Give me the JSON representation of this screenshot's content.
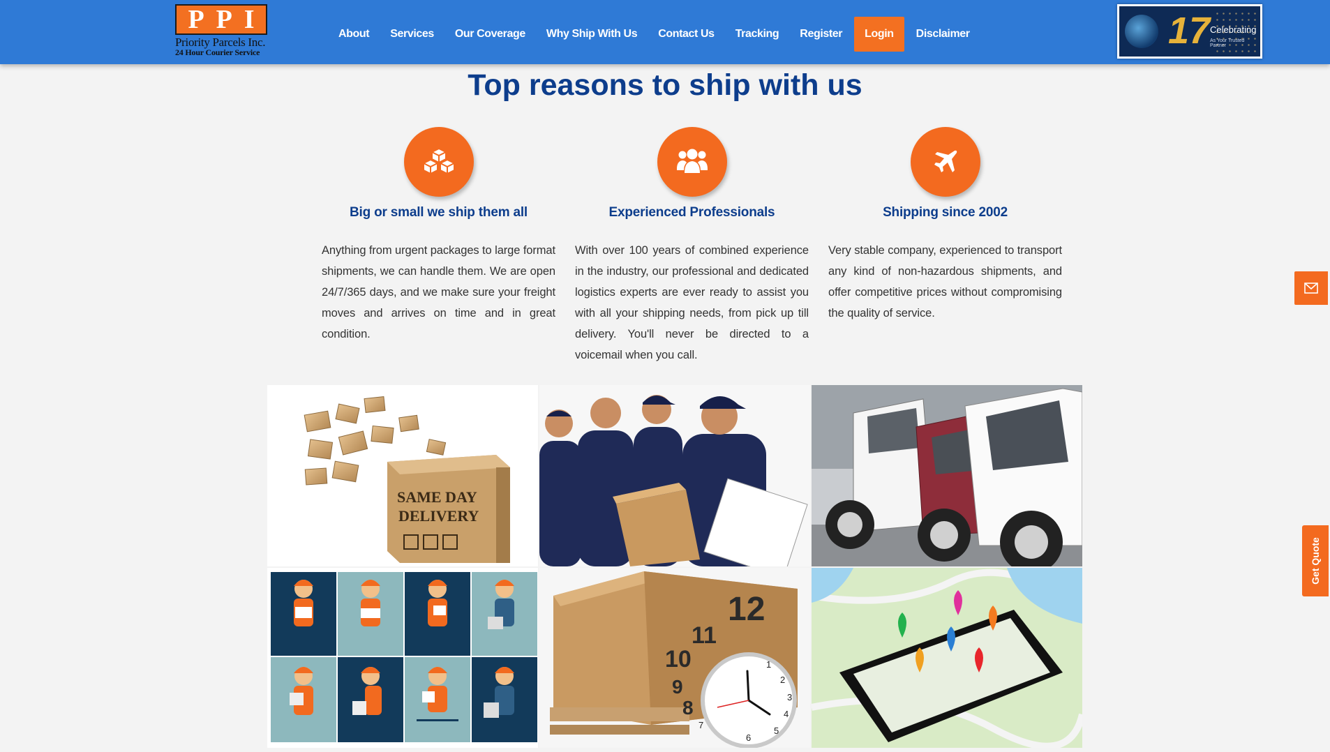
{
  "header": {
    "logo": {
      "letters": [
        "P",
        "P",
        "I"
      ],
      "name": "Priority Parcels Inc.",
      "tagline": "24 Hour Courier Service"
    },
    "nav": [
      "About",
      "Services",
      "Our Coverage",
      "Why Ship With Us",
      "Contact Us",
      "Tracking",
      "Register",
      "Login",
      "Disclaimer"
    ],
    "badge": {
      "number": "17",
      "text": "Celebrating",
      "sub": "As Your Trusted Partner"
    }
  },
  "main": {
    "title": "Top reasons to ship with us",
    "features": [
      {
        "icon": "cubes-icon",
        "title": "Big or small we ship them all",
        "text": "Anything from urgent packages to large format shipments, we can handle them. We are open 24/7/365 days, and we make sure your freight moves and arrives on time and in great condition."
      },
      {
        "icon": "users-icon",
        "title": "Experienced Professionals",
        "text": "With over 100 years of combined experience in the industry, our professional and dedicated logistics experts are ever ready to assist you with all your shipping needs, from pick up till delivery. You'll never be directed to a voicemail when you call."
      },
      {
        "icon": "plane-icon",
        "title": "Shipping since 2002",
        "text": "Very stable company, experienced to transport any kind of non-hazardous shipments, and offer competitive prices without compromising the quality of service."
      }
    ],
    "gallery": {
      "box_text_1": "SAME DAY",
      "box_text_2": "DELIVERY",
      "clock_numbers": [
        "12",
        "11",
        "10",
        "9",
        "8",
        "7",
        "6",
        "5",
        "4",
        "3",
        "2",
        "1"
      ]
    }
  },
  "widgets": {
    "quote_label": "Get Quote"
  },
  "colors": {
    "header_blue": "#2f7ad6",
    "accent_orange": "#f36a1f",
    "title_navy": "#0d3d8c"
  }
}
